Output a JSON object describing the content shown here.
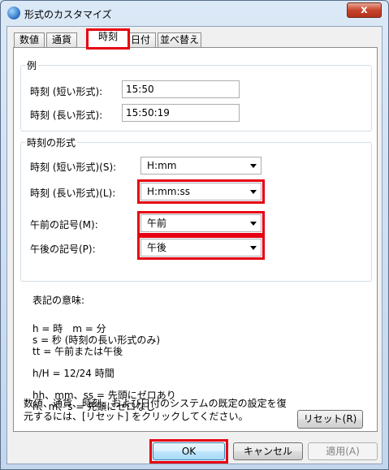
{
  "window": {
    "title": "形式のカスタマイズ",
    "close_label": "x"
  },
  "tabs": [
    {
      "label": "数値"
    },
    {
      "label": "通貨"
    },
    {
      "label": "時刻"
    },
    {
      "label": "日付"
    },
    {
      "label": "並べ替え"
    }
  ],
  "example": {
    "legend": "例",
    "short_label": "時刻 (短い形式):",
    "short_value": "15:50",
    "long_label": "時刻 (長い形式):",
    "long_value": "15:50:19"
  },
  "format": {
    "legend": "時刻の形式",
    "short_label": "時刻 (短い形式)(S):",
    "short_value": "H:mm",
    "long_label": "時刻 (長い形式)(L):",
    "long_value": "H:mm:ss",
    "am_label": "午前の記号(M):",
    "am_value": "午前",
    "pm_label": "午後の記号(P):",
    "pm_value": "午後"
  },
  "notes": {
    "heading": "表記の意味:",
    "line1": "h = 時　m = 分",
    "line2": "s = 秒 (時刻の長い形式のみ)",
    "line3": "tt = 午前または午後",
    "line4": "h/H = 12/24 時間",
    "line5": "hh、mm、ss = 先頭にゼロあり",
    "line6": "h、m、s = 先頭にゼロなし"
  },
  "reset": {
    "text": "数値、通貨、時刻、および日付のシステムの既定の設定を復元するには、[リセット] をクリックしてください。",
    "button": "リセット(R)"
  },
  "buttons": {
    "ok": "OK",
    "cancel": "キャンセル",
    "apply": "適用(A)"
  }
}
